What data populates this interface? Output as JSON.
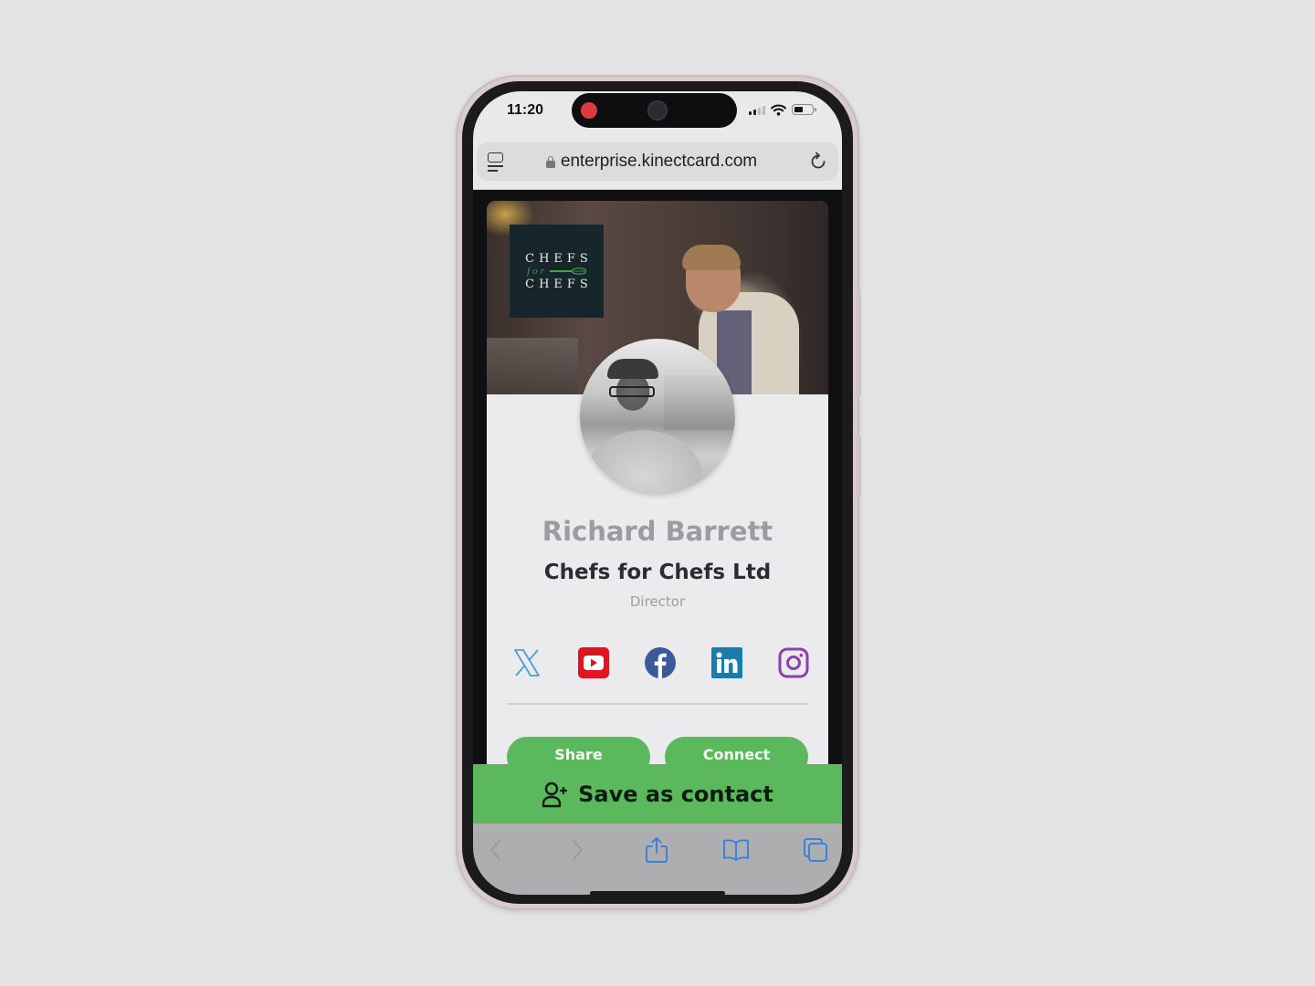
{
  "status_bar": {
    "time": "11:20",
    "recording_indicator_color": "#e03a3e"
  },
  "browser": {
    "url": "enterprise.kinectcard.com",
    "icons": {
      "tabs_overview": "sidebar-icon",
      "secure": "lock-icon",
      "reload": "reload-icon"
    }
  },
  "card": {
    "logo": {
      "line1": "CHEFS",
      "line2": "for",
      "line3": "CHEFS",
      "accent_color": "#3fa34d"
    },
    "name": "Richard Barrett",
    "company": "Chefs for Chefs Ltd",
    "role": "Director",
    "socials": [
      {
        "name": "X",
        "icon": "x-icon",
        "color": "#4aa3c8"
      },
      {
        "name": "YouTube",
        "icon": "youtube-icon",
        "color": "#e0141e"
      },
      {
        "name": "Facebook",
        "icon": "facebook-icon",
        "color": "#3b5a9a"
      },
      {
        "name": "LinkedIn",
        "icon": "linkedin-icon",
        "color": "#1a7bad"
      },
      {
        "name": "Instagram",
        "icon": "instagram-icon",
        "color": "#8c3fb0"
      }
    ],
    "actions": {
      "share_label": "Share",
      "connect_label": "Connect"
    },
    "save_contact_label": "Save as contact",
    "accent_color": "#5cb85c"
  },
  "safari_toolbar": {
    "items": [
      "back",
      "forward",
      "share",
      "bookmarks",
      "tabs"
    ],
    "active_color": "#2f7fe0"
  }
}
